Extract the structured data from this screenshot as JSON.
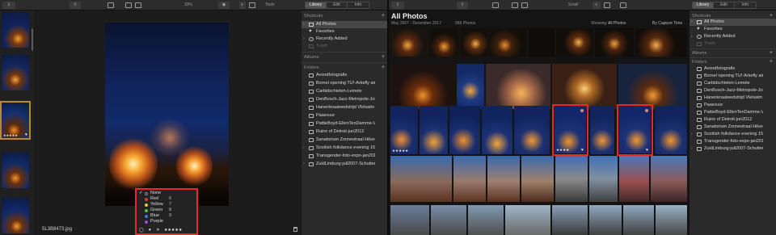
{
  "left": {
    "toolbar": {
      "zoom": "33%",
      "tools": "Tools",
      "tabs": [
        "Library",
        "Edit",
        "Info"
      ],
      "active_tab": "Library"
    },
    "filmstrip": {
      "selected_stars": "★★★★★",
      "selected_heart": "♥"
    },
    "viewer": {
      "filename": "5L3B8473.jpg"
    },
    "color_popup": {
      "options": [
        {
          "label": "None",
          "key": "",
          "color": "#2a2a2a",
          "checked": true
        },
        {
          "label": "Red",
          "key": "6",
          "color": "#d83a3a"
        },
        {
          "label": "Yellow",
          "key": "7",
          "color": "#e0c43a"
        },
        {
          "label": "Green",
          "key": "8",
          "color": "#4cc04c"
        },
        {
          "label": "Blue",
          "key": "9",
          "color": "#3a7ad8"
        },
        {
          "label": "Purple",
          "key": "",
          "color": "#9a4ad0"
        }
      ],
      "bottom_stars": "★★★★★",
      "bottom_heart": "♥",
      "bottom_reject": "✕"
    }
  },
  "sidebar": {
    "shortcuts_header": "Shortcuts",
    "shortcuts": [
      {
        "label": "All Photos",
        "count": "",
        "selected": true
      },
      {
        "label": "Favorites",
        "count": "",
        "selected": false
      },
      {
        "label": "Recently Added",
        "count": "",
        "selected": false
      },
      {
        "label": "Trash",
        "count": "",
        "selected": false
      }
    ],
    "albums_header": "Albums",
    "folders_header": "Folders",
    "folders": [
      {
        "label": "Avondfotografie",
        "count": ""
      },
      {
        "label": "Bornel opening TU!-Arkefly airlin...",
        "count": ""
      },
      {
        "label": "Carbidschieten-Lemele",
        "count": ""
      },
      {
        "label": "DenBosch-Jazz-Metropole-John...",
        "count": ""
      },
      {
        "label": "Hanenkraaiwedstrijd Vlelsalm 20...",
        "count": ""
      },
      {
        "label": "Paasvuur",
        "count": ""
      },
      {
        "label": "PattieBoyd-EllenTenDamme-VIP...",
        "count": ""
      },
      {
        "label": "Ruins of Detroit-jun2012",
        "count": ""
      },
      {
        "label": "Sanatorium Zonnestraal Hilversum",
        "count": ""
      },
      {
        "label": "Scottish folkdance evening 15de...",
        "count": ""
      },
      {
        "label": "Transgender-foto-expo-jan2010",
        "count": ""
      },
      {
        "label": "ZuidLimburg-juli2007-Schutter...",
        "count": ""
      }
    ]
  },
  "right": {
    "toolbar": {
      "view": "Small",
      "tabs": [
        "Library",
        "Edit",
        "Info"
      ],
      "active_tab": "Library"
    },
    "grid": {
      "title": "All Photos",
      "date_range": "May 2007 - December 2017",
      "photo_count": "586 Photos",
      "showing_label": "Showing:",
      "showing_value": "All Photos",
      "sort": "By Capture Time",
      "row3_first_stars": "★★★★★",
      "sel1_stars": "★★★★",
      "sel1_heart": "♥",
      "sel2_heart": "♥"
    }
  }
}
